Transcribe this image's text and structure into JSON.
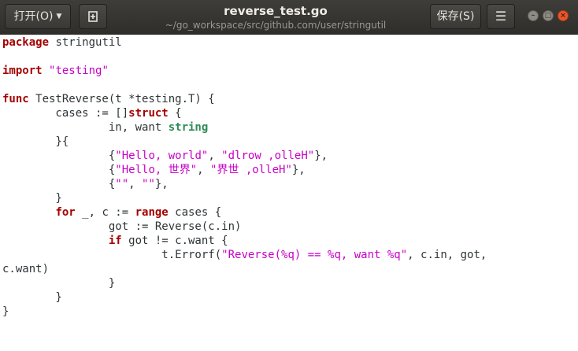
{
  "titlebar": {
    "open_label": "打开(O)",
    "title": "reverse_test.go",
    "subtitle": "~/go_workspace/src/github.com/user/stringutil",
    "save_label": "保存(S)"
  },
  "code_lines": [
    [
      {
        "t": "kw",
        "v": "package"
      },
      {
        "t": "p",
        "v": " stringutil"
      }
    ],
    [],
    [
      {
        "t": "kw",
        "v": "import"
      },
      {
        "t": "p",
        "v": " "
      },
      {
        "t": "str",
        "v": "\"testing\""
      }
    ],
    [],
    [
      {
        "t": "kw",
        "v": "func"
      },
      {
        "t": "p",
        "v": " TestReverse(t *testing.T) {"
      }
    ],
    [
      {
        "t": "p",
        "v": "        cases := []"
      },
      {
        "t": "kw",
        "v": "struct"
      },
      {
        "t": "p",
        "v": " {"
      }
    ],
    [
      {
        "t": "p",
        "v": "                in, want "
      },
      {
        "t": "ty",
        "v": "string"
      }
    ],
    [
      {
        "t": "p",
        "v": "        }{"
      }
    ],
    [
      {
        "t": "p",
        "v": "                {"
      },
      {
        "t": "str",
        "v": "\"Hello, world\""
      },
      {
        "t": "p",
        "v": ", "
      },
      {
        "t": "str",
        "v": "\"dlrow ,olleH\""
      },
      {
        "t": "p",
        "v": "},"
      }
    ],
    [
      {
        "t": "p",
        "v": "                {"
      },
      {
        "t": "str",
        "v": "\"Hello, 世界\""
      },
      {
        "t": "p",
        "v": ", "
      },
      {
        "t": "str",
        "v": "\"界世 ,olleH\""
      },
      {
        "t": "p",
        "v": "},"
      }
    ],
    [
      {
        "t": "p",
        "v": "                {"
      },
      {
        "t": "str",
        "v": "\"\""
      },
      {
        "t": "p",
        "v": ", "
      },
      {
        "t": "str",
        "v": "\"\""
      },
      {
        "t": "p",
        "v": "},"
      }
    ],
    [
      {
        "t": "p",
        "v": "        }"
      }
    ],
    [
      {
        "t": "p",
        "v": "        "
      },
      {
        "t": "kw",
        "v": "for"
      },
      {
        "t": "p",
        "v": " _, c := "
      },
      {
        "t": "kw",
        "v": "range"
      },
      {
        "t": "p",
        "v": " cases {"
      }
    ],
    [
      {
        "t": "p",
        "v": "                got := Reverse(c.in)"
      }
    ],
    [
      {
        "t": "p",
        "v": "                "
      },
      {
        "t": "kw",
        "v": "if"
      },
      {
        "t": "p",
        "v": " got != c.want {"
      }
    ],
    [
      {
        "t": "p",
        "v": "                        t.Errorf("
      },
      {
        "t": "str",
        "v": "\"Reverse(%q) == %q, want %q\""
      },
      {
        "t": "p",
        "v": ", c.in, got,"
      }
    ],
    [
      {
        "t": "p",
        "v": "c.want)"
      }
    ],
    [
      {
        "t": "p",
        "v": "                }"
      }
    ],
    [
      {
        "t": "p",
        "v": "        }"
      }
    ],
    [
      {
        "t": "p",
        "v": "}"
      }
    ]
  ]
}
